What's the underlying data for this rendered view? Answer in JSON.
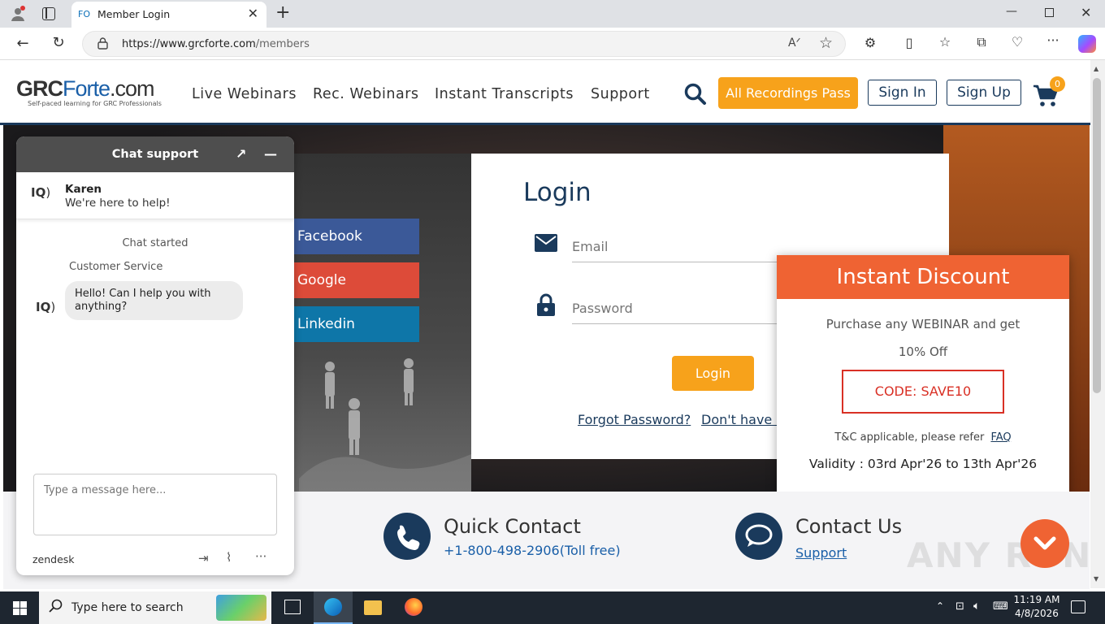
{
  "browser": {
    "tab_title": "Member Login",
    "tab_favicon": "FO",
    "url_host": "https://www.grcforte.com",
    "url_path": "/members"
  },
  "header": {
    "logo_main": "GRC",
    "logo_forte": "Forte",
    "logo_com": ".com",
    "logo_tagline": "Self-paced learning for GRC Professionals",
    "nav": [
      "Live Webinars",
      "Rec. Webinars",
      "Instant Transcripts",
      "Support"
    ],
    "pass_button": "All Recordings Pass",
    "sign_in": "Sign In",
    "sign_up": "Sign Up",
    "cart_count": "0"
  },
  "social": {
    "facebook": "Facebook",
    "google": "Google",
    "linkedin": "Linkedin",
    "colors": {
      "facebook": "#3b5998",
      "google": "#dd4b39",
      "linkedin": "#0e76a8"
    }
  },
  "login": {
    "title": "Login",
    "email_placeholder": "Email",
    "password_placeholder": "Password",
    "submit": "Login",
    "forgot": "Forgot Password?",
    "no_account": "Don't have a"
  },
  "discount": {
    "title": "Instant Discount",
    "line1": "Purchase any WEBINAR and get",
    "line2": "10% Off",
    "code": "CODE: SAVE10",
    "terms": "T&C applicable, please refer",
    "faq": "FAQ",
    "validity": "Validity : 03rd Apr'26 to 13th Apr'26"
  },
  "footer": {
    "quick_contact": "Quick Contact",
    "phone": "+1-800-498-2906(Toll free)",
    "contact_us": "Contact Us",
    "support": "Support"
  },
  "chat": {
    "header": "Chat support",
    "agent_name": "Karen",
    "agent_tagline": "We're here to help!",
    "chat_started": "Chat started",
    "sender": "Customer Service",
    "message": "Hello! Can I help you with anything?",
    "input_placeholder": "Type a message here...",
    "brand": "zendesk"
  },
  "taskbar": {
    "search_placeholder": "Type here to search",
    "time": "11:19 AM",
    "date": "4/8/2026"
  },
  "watermark": "ANY RUN"
}
